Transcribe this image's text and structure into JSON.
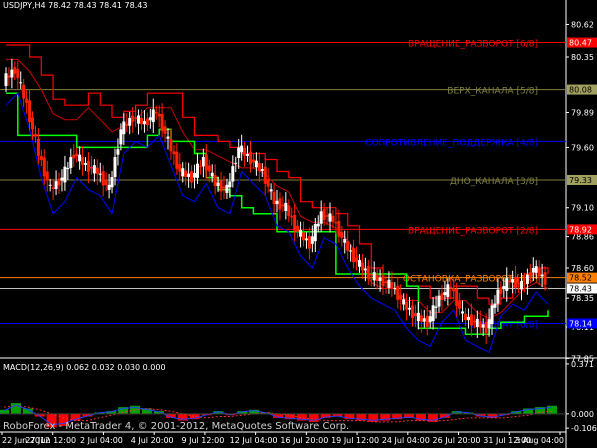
{
  "header": {
    "symbol_line": "USDJPY,H4  78.42 78.43 78.41 78.43",
    "macd_line": "MACD(12,26,9) 0.062 0.032 0.030 0.000",
    "copyright": "RoboForex - MetaTrader 4, © 2001-2012, MetaQuotes Software Corp."
  },
  "colors": {
    "background": "#000000",
    "axis": "#ffffff",
    "red_line": "#ff0000",
    "dark_red_line": "#cc0000",
    "green_line": "#00ff00",
    "blue_line": "#0000ff",
    "olive_line": "#808040",
    "orange_line": "#ff8000",
    "candle_bull": "#ffffff",
    "candle_bear": "#ff2000",
    "macd_green": "#00a000",
    "macd_red": "#ff0000",
    "signal_line": "#ff3030",
    "macd_line_blue": "#2040ff"
  },
  "price_axis": {
    "min": 77.87,
    "max": 80.74,
    "ticks": [
      "80.62",
      "80.35",
      "79.89",
      "79.60",
      "79.10",
      "78.86",
      "78.60",
      "78.35",
      "78.11",
      "77.85"
    ],
    "tick_values": [
      80.62,
      80.35,
      79.89,
      79.6,
      79.1,
      78.86,
      78.6,
      78.35,
      78.11,
      77.85
    ],
    "tags": [
      {
        "text": "80.47",
        "value": 80.47,
        "bg": "#ff0000",
        "fg": "#ffffff"
      },
      {
        "text": "80.08",
        "value": 80.08,
        "bg": "#a0a060",
        "fg": "#000000"
      },
      {
        "text": "79.33",
        "value": 79.33,
        "bg": "#a0a060",
        "fg": "#000000"
      },
      {
        "text": "78.92",
        "value": 78.92,
        "bg": "#ff0000",
        "fg": "#ffffff"
      },
      {
        "text": "78.52",
        "value": 78.52,
        "bg": "#ff8000",
        "fg": "#000000"
      },
      {
        "text": "78.43",
        "value": 78.43,
        "bg": "#ffffff",
        "fg": "#000000"
      },
      {
        "text": "78.14",
        "value": 78.14,
        "bg": "#0000ff",
        "fg": "#ffffff"
      }
    ]
  },
  "murrey_levels": [
    {
      "label": "ВРАЩЕНИЕ_РАЗВОРОТ [6/8]",
      "value": 80.47,
      "color": "#ff0000"
    },
    {
      "label": "ВЕРХ_КАНАЛА [5/8]",
      "value": 80.08,
      "color": "#808040"
    },
    {
      "label": "СОПРОТИВЛЕНИЕ_ПОДДЕРЖКА [4/8]",
      "value": 79.65,
      "color": "#0000ff"
    },
    {
      "label": "ДНО_КАНАЛА [3/8]",
      "value": 79.33,
      "color": "#808040"
    },
    {
      "label": "ВРАЩЕНИЕ_РАЗВОРОТ [2/8]",
      "value": 78.92,
      "color": "#ff0000"
    },
    {
      "label": "ОСТАНОВКА_РАЗВОРОТ [1/8]",
      "value": 78.52,
      "color": "#ff8000"
    },
    {
      "label": "ВОЗВРАТ [0/8]",
      "value": 78.14,
      "color": "#0000ff"
    }
  ],
  "bid_line": {
    "value": 78.43
  },
  "chart_data": {
    "type": "candlestick",
    "symbol": "USDJPY",
    "timeframe": "H4",
    "ylim": [
      77.87,
      80.74
    ],
    "time_labels": [
      "22 Jun 2012",
      "27 Jun 12:00",
      "2 Jul 04:00",
      "4 Jul 20:00",
      "9 Jul 12:00",
      "12 Jul 04:00",
      "16 Jul 20:00",
      "19 Jul 12:00",
      "24 Jul 04:00",
      "26 Jul 20:00",
      "31 Jul 12:00",
      "3 Aug 04:00"
    ],
    "close_path": [
      80.15,
      80.25,
      79.95,
      79.55,
      79.25,
      79.35,
      79.55,
      79.45,
      79.4,
      79.25,
      79.75,
      79.85,
      79.8,
      79.9,
      79.65,
      79.4,
      79.35,
      79.5,
      79.3,
      79.25,
      79.6,
      79.5,
      79.4,
      79.15,
      79.1,
      78.9,
      78.8,
      79.05,
      79.0,
      78.8,
      78.65,
      78.55,
      78.5,
      78.45,
      78.3,
      78.2,
      78.15,
      78.35,
      78.45,
      78.2,
      78.15,
      78.1,
      78.4,
      78.5,
      78.45,
      78.6,
      78.5
    ],
    "red_stop_upper": [
      80.45,
      80.45,
      80.35,
      80.2,
      80.0,
      79.95,
      79.95,
      80.05,
      79.95,
      79.85,
      79.9,
      79.95,
      80.05,
      80.05,
      80.05,
      79.85,
      79.7,
      79.7,
      79.65,
      79.6,
      79.55,
      79.55,
      79.5,
      79.4,
      79.35,
      79.15,
      79.1,
      79.1,
      79.05,
      78.95,
      78.8,
      78.6,
      78.55,
      78.55,
      78.45,
      78.45,
      78.35,
      78.35,
      78.45,
      78.45,
      78.35,
      78.3,
      78.35,
      78.45,
      78.55,
      78.6,
      78.55
    ],
    "green_stop_lower": [
      80.05,
      79.7,
      79.7,
      79.7,
      79.7,
      79.7,
      79.6,
      79.6,
      79.6,
      79.6,
      79.6,
      79.6,
      79.7,
      79.75,
      79.65,
      79.65,
      79.55,
      79.35,
      79.25,
      79.2,
      79.1,
      79.05,
      79.05,
      78.9,
      78.9,
      78.9,
      78.9,
      78.9,
      78.55,
      78.55,
      78.55,
      78.55,
      78.55,
      78.55,
      78.45,
      78.1,
      78.1,
      78.1,
      78.1,
      78.05,
      78.05,
      78.1,
      78.15,
      78.15,
      78.2,
      78.2,
      78.25
    ],
    "macd_axis": {
      "ticks": [
        "0.371",
        "0.000",
        "-0.106"
      ],
      "tick_values": [
        0.371,
        0.0,
        -0.106
      ],
      "min": -0.12,
      "max": 0.4
    },
    "macd_hist": [
      0.03,
      0.08,
      0.04,
      -0.02,
      -0.1,
      -0.09,
      -0.05,
      -0.02,
      0.01,
      0.02,
      0.05,
      0.06,
      0.04,
      0.02,
      -0.03,
      -0.05,
      -0.04,
      -0.01,
      0.02,
      -0.01,
      0.02,
      0.03,
      0.01,
      -0.03,
      -0.04,
      -0.05,
      -0.06,
      -0.03,
      -0.02,
      -0.04,
      -0.05,
      -0.06,
      -0.05,
      -0.04,
      -0.03,
      -0.05,
      -0.06,
      -0.03,
      0.02,
      0.01,
      -0.02,
      -0.03,
      -0.01,
      0.02,
      0.04,
      0.05,
      0.06
    ],
    "macd_signal": [
      0.05,
      0.06,
      0.05,
      0.03,
      0.0,
      -0.03,
      -0.05,
      -0.05,
      -0.03,
      -0.01,
      0.01,
      0.03,
      0.04,
      0.03,
      0.02,
      0.0,
      -0.02,
      -0.03,
      -0.02,
      -0.02,
      -0.01,
      0.0,
      0.01,
      0.0,
      -0.01,
      -0.03,
      -0.04,
      -0.05,
      -0.05,
      -0.05,
      -0.05,
      -0.06,
      -0.06,
      -0.06,
      -0.05,
      -0.05,
      -0.05,
      -0.05,
      -0.04,
      -0.03,
      -0.03,
      -0.03,
      -0.03,
      -0.02,
      -0.01,
      0.01,
      0.02
    ]
  }
}
